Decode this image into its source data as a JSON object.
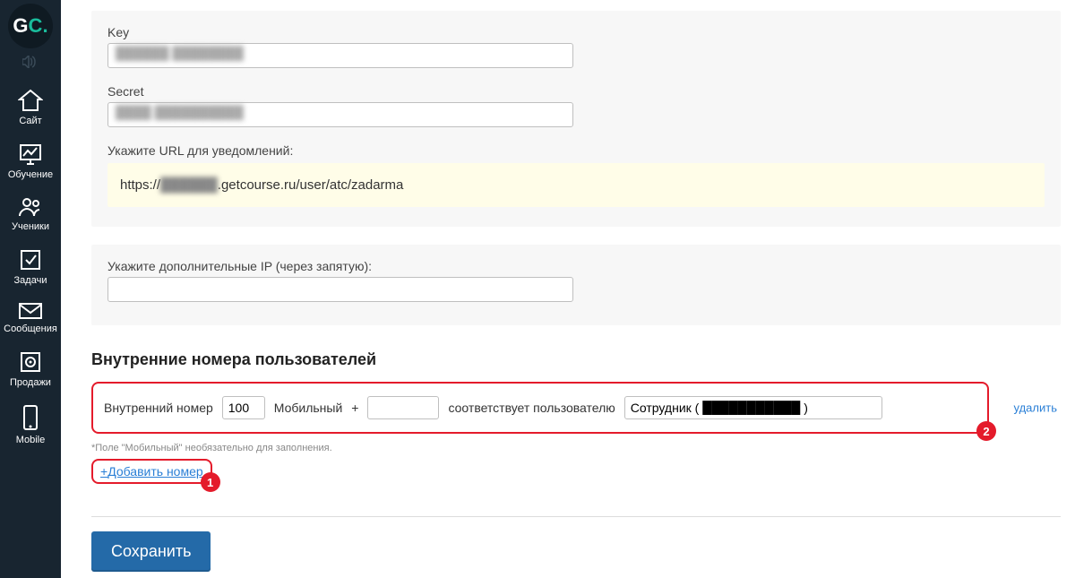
{
  "logo": {
    "g": "G",
    "c": "C",
    "dot": "."
  },
  "sidebar": {
    "items": [
      {
        "label": "Сайт"
      },
      {
        "label": "Обучение"
      },
      {
        "label": "Ученики"
      },
      {
        "label": "Задачи"
      },
      {
        "label": "Сообщения"
      },
      {
        "label": "Продажи"
      },
      {
        "label": "Mobile"
      }
    ]
  },
  "form": {
    "key_label": "Key",
    "key_value": "██████ ████████",
    "secret_label": "Secret",
    "secret_value": "████ ██████████",
    "url_label": "Укажите URL для уведомлений:",
    "url_prefix": "https://",
    "url_hidden": "██████",
    "url_suffix": ".getcourse.ru/user/atc/zadarma",
    "ip_label": "Укажите дополнительные IP (через запятую):",
    "ip_value": ""
  },
  "section": {
    "title": "Внутренние номера пользователей",
    "internal_number_label": "Внутренний номер",
    "internal_number_value": "100",
    "mobile_label": "Мобильный",
    "mobile_prefix": "+",
    "mobile_value": "",
    "maps_to_label": "соответствует пользователю",
    "user_value": "Сотрудник ( ███████████ )",
    "delete_label": "удалить",
    "note": "*Поле \"Мобильный\" необязательно для заполнения.",
    "add_label": "Добавить номер",
    "add_plus": "+",
    "badge1": "1",
    "badge2": "2"
  },
  "actions": {
    "save": "Сохранить"
  }
}
